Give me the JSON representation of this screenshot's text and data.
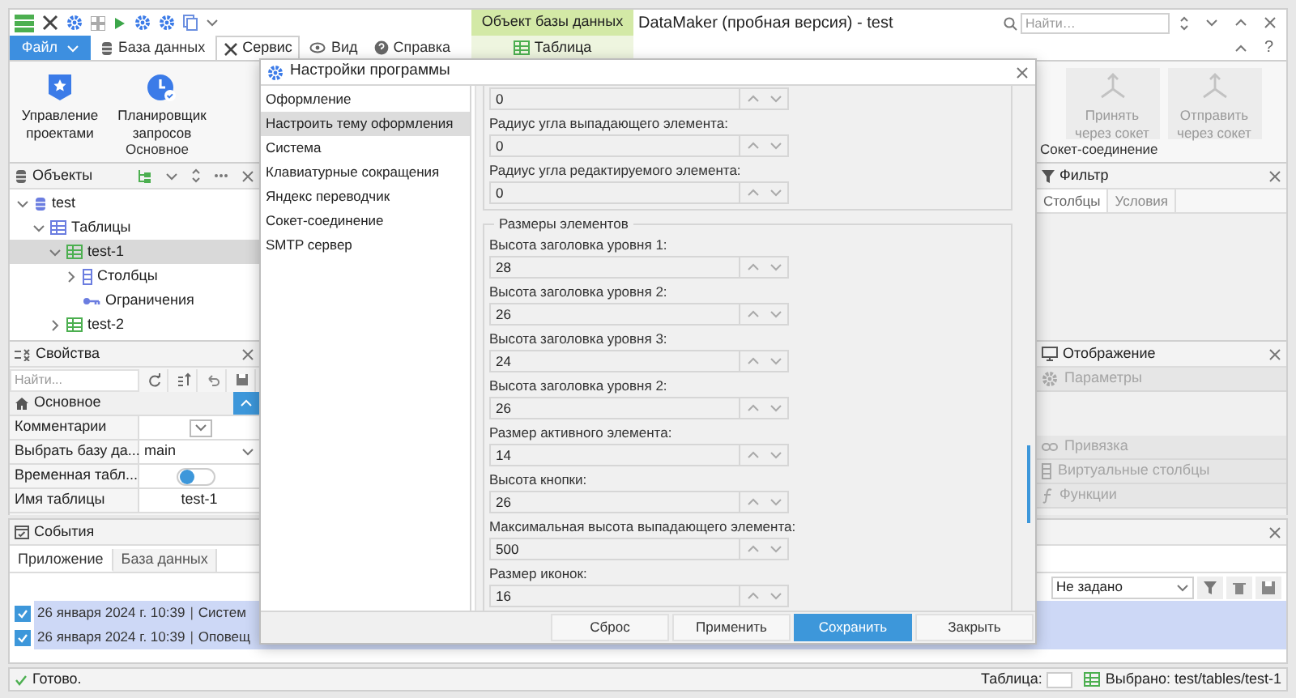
{
  "window": {
    "title": "DataMaker (пробная версия) - test",
    "search_placeholder": "Найти…",
    "help": "?"
  },
  "context": {
    "group": "Объект базы данных",
    "tab": "Таблица"
  },
  "tabs": [
    {
      "label": "Файл",
      "kind": "file",
      "selected": false
    },
    {
      "label": "База данных",
      "kind": "tab",
      "selected": false
    },
    {
      "label": "Сервис",
      "kind": "tab",
      "selected": true
    },
    {
      "label": "Вид",
      "kind": "tab",
      "selected": false
    },
    {
      "label": "Справка",
      "kind": "tab",
      "selected": false
    }
  ],
  "ribbon": [
    {
      "label": "Основное",
      "buttons": [
        {
          "lines": [
            "Управление",
            "проектами"
          ],
          "disabled": false
        },
        {
          "lines": [
            "Планировщик",
            "запросов"
          ],
          "disabled": false
        }
      ]
    },
    {
      "label": "Сокет-соединение",
      "buttons": [
        {
          "lines": [
            "Принять",
            "через сокет"
          ],
          "disabled": true
        },
        {
          "lines": [
            "Отправить",
            "через сокет"
          ],
          "disabled": true
        }
      ]
    }
  ],
  "objects": {
    "title": "Объекты",
    "tree": [
      {
        "label": "test",
        "kind": "database",
        "expanded": true,
        "selected": false,
        "children": [
          {
            "label": "Таблицы",
            "kind": "folder",
            "expanded": true,
            "selected": false,
            "children": [
              {
                "label": "test-1",
                "kind": "table",
                "expanded": true,
                "selected": true,
                "children": [
                  {
                    "label": "Столбцы",
                    "kind": "columns",
                    "expanded": false,
                    "selected": false
                  },
                  {
                    "label": "Ограничения",
                    "kind": "key",
                    "selected": false
                  }
                ]
              },
              {
                "label": "test-2",
                "kind": "table",
                "expanded": false,
                "selected": false
              }
            ]
          }
        ]
      }
    ]
  },
  "properties": {
    "title": "Свойства",
    "search_placeholder": "Найти...",
    "section": "Основное",
    "section_expanded": true,
    "rows": [
      {
        "name": "Комментарии",
        "kind": "dropdown"
      },
      {
        "name": "Выбрать базу да...",
        "kind": "select",
        "value": "main"
      },
      {
        "name": "Временная табл...",
        "kind": "toggle",
        "on": false
      },
      {
        "name": "Имя таблицы",
        "kind": "text",
        "value": "test-1"
      }
    ]
  },
  "filter": {
    "title": "Фильтр",
    "tabs": [
      {
        "label": "Столбцы",
        "selected": true
      },
      {
        "label": "Условия",
        "selected": false
      }
    ]
  },
  "display": {
    "title": "Отображение",
    "sections": [
      {
        "label": "Параметры",
        "disabled": true
      },
      {
        "label": "Привязка",
        "disabled": true
      },
      {
        "label": "Виртуальные столбцы",
        "disabled": true
      },
      {
        "label": "Функции",
        "disabled": true
      }
    ]
  },
  "events": {
    "title": "События",
    "tabs": [
      {
        "label": "Приложение",
        "selected": true
      },
      {
        "label": "База данных",
        "selected": false
      }
    ],
    "filter": "Не задано",
    "rows": [
      {
        "checked": true,
        "time": "26 января 2024 г. 10:39",
        "separator": "|",
        "message": "Систем"
      },
      {
        "checked": true,
        "time": "26 января 2024 г. 10:39",
        "separator": "|",
        "message": "Оповещ"
      }
    ]
  },
  "status_bar": {
    "message": "Готово.",
    "table_label": "Таблица:",
    "selection": "Выбрано: test/tables/test-1"
  },
  "dialog": {
    "title": "Настройки программы",
    "nav": [
      {
        "label": "Оформление",
        "selected": false
      },
      {
        "label": "Настроить тему оформления",
        "selected": true
      },
      {
        "label": "Система",
        "selected": false
      },
      {
        "label": "Клавиатурные сокращения",
        "selected": false
      },
      {
        "label": "Яндекс переводчик",
        "selected": false
      },
      {
        "label": "Сокет-соединение",
        "selected": false
      },
      {
        "label": "SMTP сервер",
        "selected": false
      }
    ],
    "groups": [
      {
        "fields": [
          {
            "value": "0"
          },
          {
            "label": "Радиус угла выпадающего элемента:",
            "value": "0"
          },
          {
            "label": "Радиус угла редактируемого элемента:",
            "value": "0"
          }
        ]
      },
      {
        "legend": "Размеры элементов",
        "fields": [
          {
            "label": "Высота заголовка уровня 1:",
            "value": "28"
          },
          {
            "label": "Высота заголовка уровня 2:",
            "value": "26"
          },
          {
            "label": "Высота заголовка уровня 3:",
            "value": "24"
          },
          {
            "label": "Высота заголовка уровня 2:",
            "value": "26"
          },
          {
            "label": "Размер активного элемента:",
            "value": "14"
          },
          {
            "label": "Высота кнопки:",
            "value": "26"
          },
          {
            "label": "Максимальная высота выпадающего элемента:",
            "value": "500"
          },
          {
            "label": "Размер иконок:",
            "value": "16"
          }
        ]
      }
    ],
    "buttons": [
      {
        "label": "Сброс",
        "primary": false
      },
      {
        "label": "Применить",
        "primary": false
      },
      {
        "label": "Сохранить",
        "primary": true
      },
      {
        "label": "Закрыть",
        "primary": false
      }
    ]
  }
}
